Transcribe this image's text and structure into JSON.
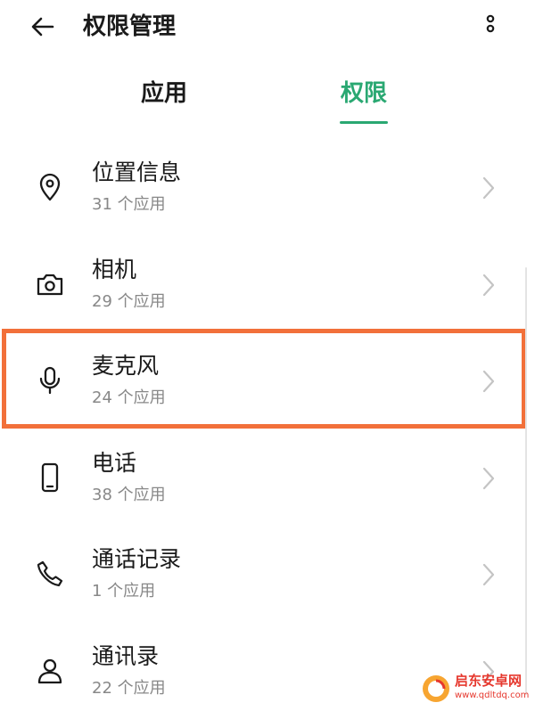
{
  "header": {
    "title": "权限管理",
    "back_icon": "arrow-left-icon",
    "more_icon": "more-vertical-icon"
  },
  "tabs": [
    {
      "label": "应用",
      "selected": false
    },
    {
      "label": "权限",
      "selected": true
    }
  ],
  "colors": {
    "accent": "#2aa872",
    "highlight": "#f2703a",
    "text_primary": "#1a1a1a",
    "text_secondary": "#888888"
  },
  "permissions": [
    {
      "title": "位置信息",
      "subtitle": "31 个应用",
      "icon": "location-pin-icon"
    },
    {
      "title": "相机",
      "subtitle": "29 个应用",
      "icon": "camera-icon"
    },
    {
      "title": "麦克风",
      "subtitle": "24 个应用",
      "icon": "microphone-icon",
      "highlighted": true
    },
    {
      "title": "电话",
      "subtitle": "38 个应用",
      "icon": "phone-device-icon"
    },
    {
      "title": "通话记录",
      "subtitle": "1 个应用",
      "icon": "phone-handset-icon"
    },
    {
      "title": "通讯录",
      "subtitle": "22 个应用",
      "icon": "contacts-icon"
    }
  ],
  "watermark": {
    "name": "启东安卓网",
    "url": "www.qdltdq.com"
  }
}
